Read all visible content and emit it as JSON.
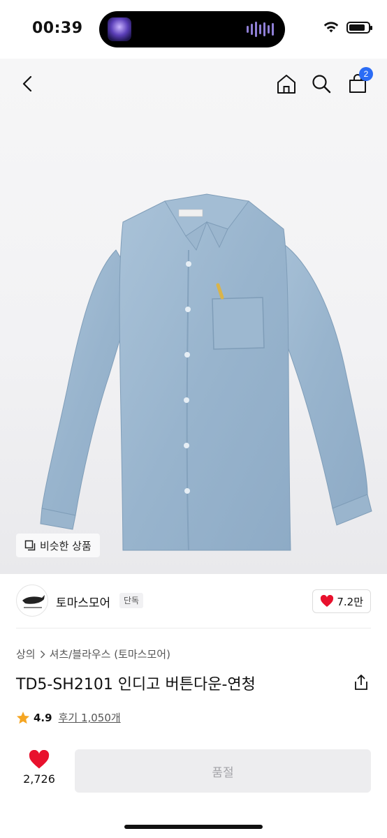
{
  "status_bar": {
    "time": "00:39",
    "battery_level": 0.85
  },
  "nav": {
    "icons": [
      "back-icon",
      "home-icon",
      "search-icon",
      "cart-icon"
    ],
    "cart_count": "2"
  },
  "hero": {
    "similar_button_label": "비슷한 상품"
  },
  "brand": {
    "name": "토마스모어",
    "tag": "단독",
    "likes": "7.2만"
  },
  "product": {
    "breadcrumb": [
      "상의",
      "셔츠/블라우스 (토마스모어)"
    ],
    "title": "TD5-SH2101 인디고 버튼다운-연청",
    "rating": "4.9",
    "review_link": "후기 1,050개"
  },
  "bottom_bar": {
    "like_count": "2,726",
    "buy_label": "품절"
  },
  "colors": {
    "accent_blue": "#2b6cf5",
    "heart_red": "#e8112d",
    "star_orange": "#f5a623",
    "disabled_bg": "#ededef"
  }
}
